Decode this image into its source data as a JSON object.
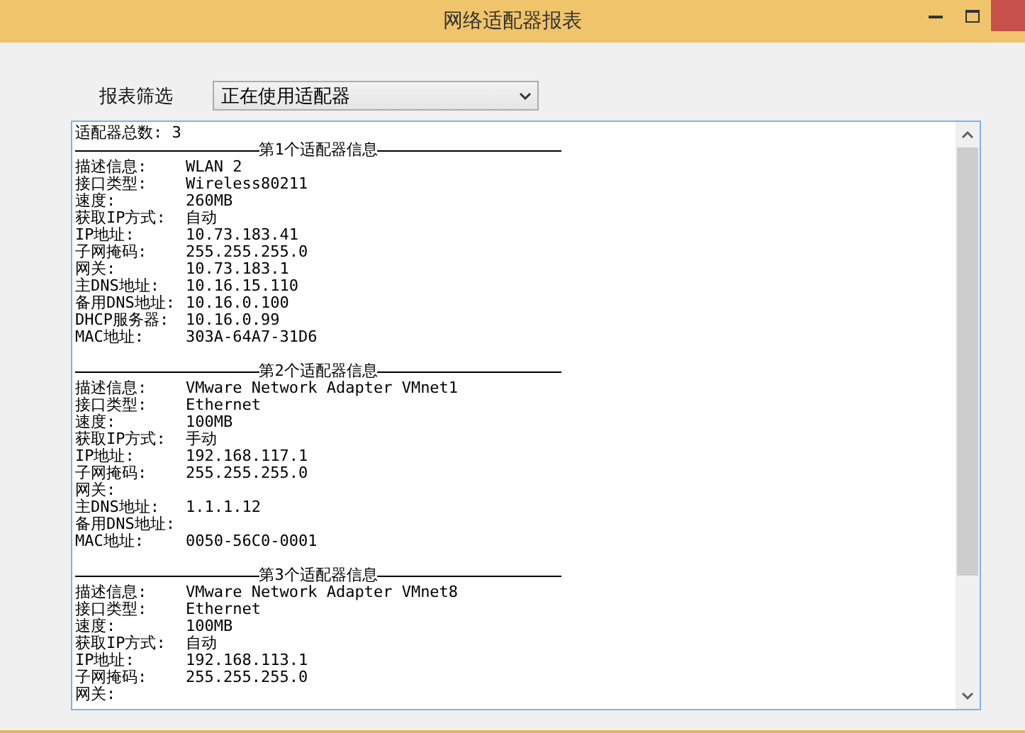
{
  "window": {
    "title": "网络适配器报表"
  },
  "filter": {
    "label": "报表筛选",
    "value": "正在使用适配器"
  },
  "report": {
    "total": "适配器总数: 3",
    "adapters": [
      {
        "header": "第1个适配器信息",
        "fields": [
          {
            "label": "描述信息:",
            "value": "WLAN 2"
          },
          {
            "label": "接口类型:",
            "value": "Wireless80211"
          },
          {
            "label": "速度:",
            "value": "260MB"
          },
          {
            "label": "获取IP方式:",
            "value": "自动"
          },
          {
            "label": "IP地址:",
            "value": "10.73.183.41"
          },
          {
            "label": "子网掩码:",
            "value": "255.255.255.0"
          },
          {
            "label": "网关:",
            "value": "10.73.183.1"
          },
          {
            "label": "主DNS地址:",
            "value": "10.16.15.110"
          },
          {
            "label": "备用DNS地址:",
            "value": "10.16.0.100"
          },
          {
            "label": "DHCP服务器:",
            "value": "10.16.0.99"
          },
          {
            "label": "MAC地址:",
            "value": "303A-64A7-31D6"
          }
        ]
      },
      {
        "header": "第2个适配器信息",
        "fields": [
          {
            "label": "描述信息:",
            "value": "VMware Network Adapter VMnet1"
          },
          {
            "label": "接口类型:",
            "value": "Ethernet"
          },
          {
            "label": "速度:",
            "value": "100MB"
          },
          {
            "label": "获取IP方式:",
            "value": "手动"
          },
          {
            "label": "IP地址:",
            "value": "192.168.117.1"
          },
          {
            "label": "子网掩码:",
            "value": "255.255.255.0"
          },
          {
            "label": "网关:"
          },
          {
            "label": "主DNS地址:",
            "value": "1.1.1.12"
          },
          {
            "label": "备用DNS地址:"
          },
          {
            "label": "MAC地址:",
            "value": "0050-56C0-0001"
          }
        ]
      },
      {
        "header": "第3个适配器信息",
        "fields": [
          {
            "label": "描述信息:",
            "value": "VMware Network Adapter VMnet8"
          },
          {
            "label": "接口类型:",
            "value": "Ethernet"
          },
          {
            "label": "速度:",
            "value": "100MB"
          },
          {
            "label": "获取IP方式:",
            "value": "自动"
          },
          {
            "label": "IP地址:",
            "value": "192.168.113.1"
          },
          {
            "label": "子网掩码:",
            "value": "255.255.255.0"
          },
          {
            "label": "网关:"
          }
        ]
      }
    ]
  }
}
